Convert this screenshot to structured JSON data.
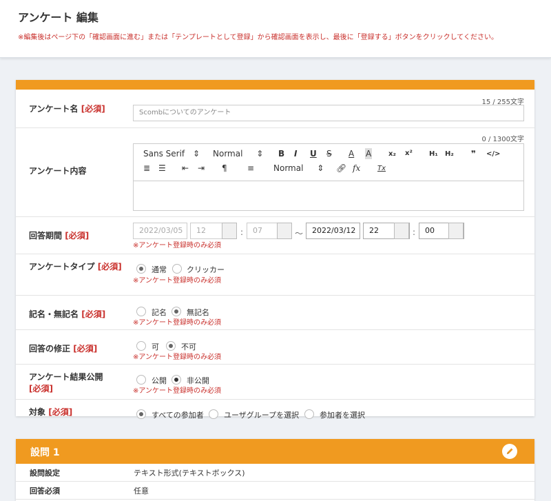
{
  "header": {
    "title": "アンケート 編集",
    "notice": "※編集後はページ下の「確認画面に進む」または「テンプレートとして登録」から確認画面を表示し、最後に「登録する」ボタンをクリックしてください。"
  },
  "form": {
    "required_tag": "[必須]",
    "required_note": "※アンケート登録時のみ必須",
    "name": {
      "label": "アンケート名",
      "counter": "15 / 255文字",
      "value": "Scombについてのアンケート"
    },
    "content": {
      "label": "アンケート内容",
      "counter": "0  / 1300文字",
      "toolbar": {
        "font": "Sans Serif",
        "size": "Normal",
        "header": "Normal",
        "bold": "B",
        "italic": "I",
        "underline": "U",
        "strike": "S",
        "color": "A",
        "background": "A",
        "sub": "x₂",
        "sup": "x²",
        "h1": "H₁",
        "h2": "H₂",
        "quote": "❞",
        "code": "</>",
        "fx": "fx",
        "clear": "Tx"
      }
    },
    "period": {
      "label": "回答期間",
      "start_date": "2022/03/05",
      "start_hour": "12",
      "start_min": "07",
      "tilde": "～",
      "end_date": "2022/03/12",
      "end_hour": "22",
      "end_min": "00"
    },
    "type": {
      "label": "アンケートタイプ",
      "options": [
        "通常",
        "クリッカー"
      ],
      "selected": "通常"
    },
    "named": {
      "label": "記名・無記名",
      "options": [
        "記名",
        "無記名"
      ],
      "selected": "無記名"
    },
    "edit": {
      "label": "回答の修正",
      "options": [
        "可",
        "不可"
      ],
      "selected": "不可"
    },
    "publish": {
      "label": "アンケート結果公開",
      "options": [
        "公開",
        "非公開"
      ],
      "selected": "非公開"
    },
    "target": {
      "label": "対象",
      "options": [
        "すべての参加者",
        "ユーザグループを選択",
        "参加者を選択"
      ],
      "selected": "すべての参加者"
    }
  },
  "question": {
    "title": "設問 1",
    "rows": [
      {
        "key": "設問設定",
        "value": "テキスト形式(テキストボックス)"
      },
      {
        "key": "回答必須",
        "value": "任意"
      }
    ]
  },
  "colors": {
    "accent": "#f09a20",
    "required": "#c9302c"
  }
}
